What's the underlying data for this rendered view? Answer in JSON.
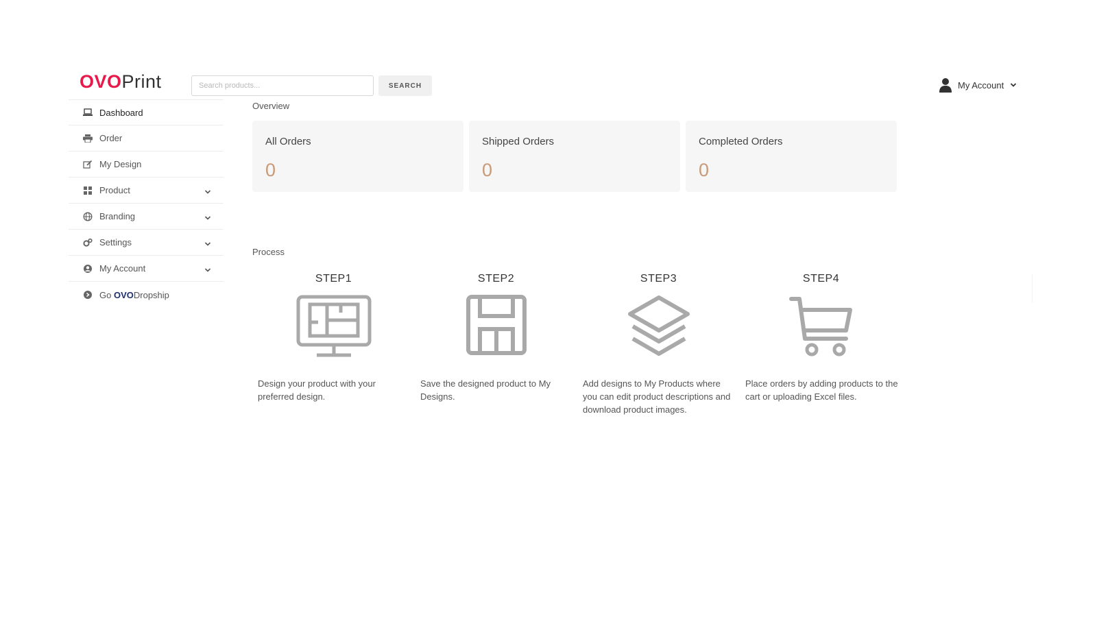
{
  "header": {
    "logo_ovo": "OVO",
    "logo_print": "Print",
    "search_placeholder": "Search products...",
    "search_button": "SEARCH",
    "account_label": "My Account"
  },
  "sidebar": {
    "items": [
      {
        "label": "Dashboard",
        "icon": "laptop-icon"
      },
      {
        "label": "Order",
        "icon": "printer-icon"
      },
      {
        "label": "My Design",
        "icon": "edit-icon"
      },
      {
        "label": "Product",
        "icon": "grid-icon"
      },
      {
        "label": "Branding",
        "icon": "globe-icon"
      },
      {
        "label": "Settings",
        "icon": "gears-icon"
      },
      {
        "label": "My Account",
        "icon": "user-circle-icon"
      },
      {
        "label_prefix": "Go ",
        "label_bold": "OVO",
        "label_suffix": "Dropship",
        "icon": "arrow-circle-icon"
      }
    ]
  },
  "overview": {
    "title": "Overview",
    "cards": [
      {
        "title": "All Orders",
        "value": "0"
      },
      {
        "title": "Shipped Orders",
        "value": "0"
      },
      {
        "title": "Completed Orders",
        "value": "0"
      }
    ]
  },
  "process": {
    "title": "Process",
    "steps": [
      {
        "title": "STEP1",
        "icon": "monitor-design-icon",
        "desc": "Design your product with your preferred design."
      },
      {
        "title": "STEP2",
        "icon": "floppy-save-icon",
        "desc": "Save the designed product to My Designs."
      },
      {
        "title": "STEP3",
        "icon": "layers-icon",
        "desc": "Add designs to My Products where you can edit product descriptions and download product images."
      },
      {
        "title": "STEP4",
        "icon": "shopping-cart-icon",
        "desc": "Place orders by adding products to the cart or uploading Excel files."
      }
    ]
  },
  "colors": {
    "brand_red": "#e8194b",
    "brand_navy": "#1f2f6e",
    "card_value": "#c89a78",
    "card_bg": "#f6f6f6",
    "icon_gray": "#a9a9a9"
  }
}
